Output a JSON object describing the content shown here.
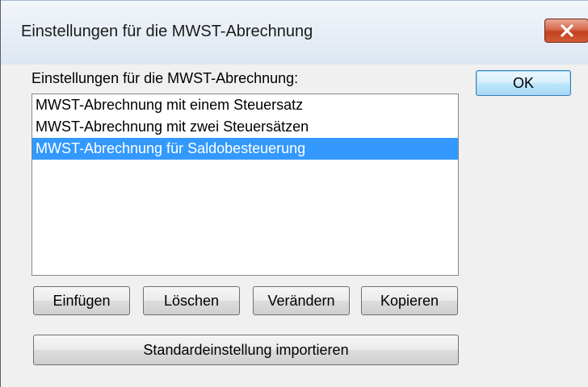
{
  "window": {
    "title": "Einstellungen für die MWST-Abrechnung",
    "close_label": "Schließen"
  },
  "list": {
    "label": "Einstellungen für die MWST-Abrechnung:",
    "items": [
      {
        "label": "MWST-Abrechnung mit einem Steuersatz",
        "selected": false
      },
      {
        "label": "MWST-Abrechnung mit zwei Steuersätzen",
        "selected": false
      },
      {
        "label": "MWST-Abrechnung für Saldobesteuerung",
        "selected": true
      }
    ]
  },
  "buttons": {
    "ok": "OK",
    "insert": "Einfügen",
    "delete": "Löschen",
    "edit": "Verändern",
    "copy": "Kopieren",
    "import_defaults": "Standardeinstellung importieren"
  },
  "colors": {
    "selection": "#3399ff",
    "close_button": "#c4411f"
  }
}
